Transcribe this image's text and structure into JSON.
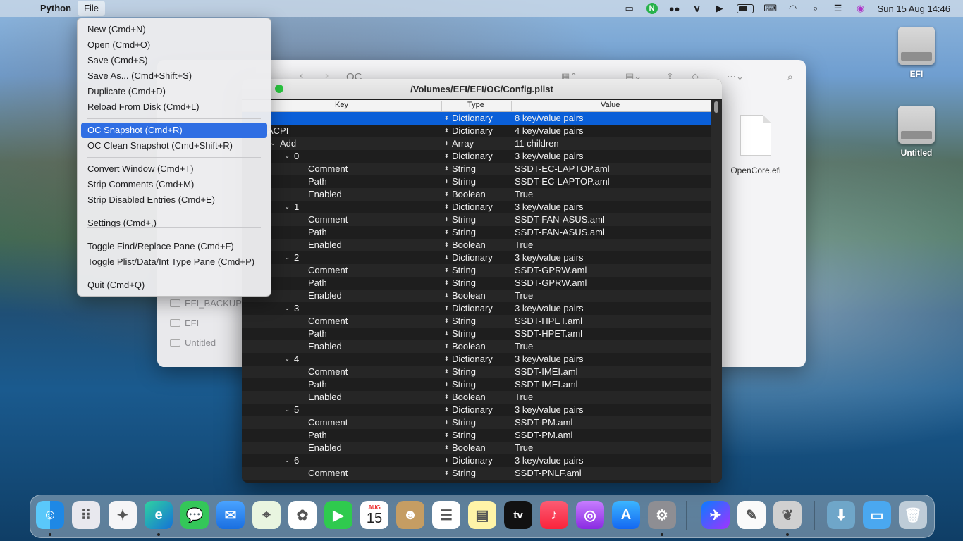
{
  "menubar": {
    "app_name": "Python",
    "menus": [
      "File"
    ],
    "status_icons": [
      "disk-utility-icon",
      "n-app-icon",
      "dots-icon",
      "v-app-icon",
      "play-icon",
      "battery-icon",
      "keyboard-icon",
      "wifi-icon",
      "search-icon",
      "control-center-icon",
      "siri-icon"
    ],
    "clock": "Sun 15 Aug  14:46"
  },
  "file_menu": {
    "items": [
      "New (Cmd+N)",
      "Open (Cmd+O)",
      "Save (Cmd+S)",
      "Save As... (Cmd+Shift+S)",
      "Duplicate (Cmd+D)",
      "Reload From Disk (Cmd+L)",
      "OC Snapshot (Cmd+R)",
      "OC Clean Snapshot (Cmd+Shift+R)",
      "Convert Window (Cmd+T)",
      "Strip Comments (Cmd+M)",
      "Strip Disabled Entries (Cmd+E)",
      "Settings (Cmd+,)",
      "Toggle Find/Replace Pane (Cmd+F)",
      "Toggle Plist/Data/Int Type Pane (Cmd+P)",
      "Quit (Cmd+Q)"
    ],
    "highlighted": "OC Snapshot (Cmd+R)"
  },
  "finder": {
    "title": "OC",
    "sidebar": [
      "EFI_BACKUP",
      "EFI",
      "Untitled"
    ],
    "file_name": "OpenCore.efi"
  },
  "plist": {
    "title": "/Volumes/EFI/EFI/OC/Config.plist",
    "col_key": "Key",
    "col_type": "Type",
    "col_value": "Value",
    "rows": [
      {
        "key": "",
        "type": "Dictionary",
        "value": "8 key/value pairs"
      },
      {
        "key": "ACPI",
        "type": "Dictionary",
        "value": "4 key/value pairs"
      },
      {
        "key": "Add",
        "type": "Array",
        "value": "11 children"
      },
      {
        "key": "0",
        "type": "Dictionary",
        "value": "3 key/value pairs"
      },
      {
        "key": "Comment",
        "type": "String",
        "value": "SSDT-EC-LAPTOP.aml"
      },
      {
        "key": "Path",
        "type": "String",
        "value": "SSDT-EC-LAPTOP.aml"
      },
      {
        "key": "Enabled",
        "type": "Boolean",
        "value": "True"
      },
      {
        "key": "1",
        "type": "Dictionary",
        "value": "3 key/value pairs"
      },
      {
        "key": "Comment",
        "type": "String",
        "value": "SSDT-FAN-ASUS.aml"
      },
      {
        "key": "Path",
        "type": "String",
        "value": "SSDT-FAN-ASUS.aml"
      },
      {
        "key": "Enabled",
        "type": "Boolean",
        "value": "True"
      },
      {
        "key": "2",
        "type": "Dictionary",
        "value": "3 key/value pairs"
      },
      {
        "key": "Comment",
        "type": "String",
        "value": "SSDT-GPRW.aml"
      },
      {
        "key": "Path",
        "type": "String",
        "value": "SSDT-GPRW.aml"
      },
      {
        "key": "Enabled",
        "type": "Boolean",
        "value": "True"
      },
      {
        "key": "3",
        "type": "Dictionary",
        "value": "3 key/value pairs"
      },
      {
        "key": "Comment",
        "type": "String",
        "value": "SSDT-HPET.aml"
      },
      {
        "key": "Path",
        "type": "String",
        "value": "SSDT-HPET.aml"
      },
      {
        "key": "Enabled",
        "type": "Boolean",
        "value": "True"
      },
      {
        "key": "4",
        "type": "Dictionary",
        "value": "3 key/value pairs"
      },
      {
        "key": "Comment",
        "type": "String",
        "value": "SSDT-IMEI.aml"
      },
      {
        "key": "Path",
        "type": "String",
        "value": "SSDT-IMEI.aml"
      },
      {
        "key": "Enabled",
        "type": "Boolean",
        "value": "True"
      },
      {
        "key": "5",
        "type": "Dictionary",
        "value": "3 key/value pairs"
      },
      {
        "key": "Comment",
        "type": "String",
        "value": "SSDT-PM.aml"
      },
      {
        "key": "Path",
        "type": "String",
        "value": "SSDT-PM.aml"
      },
      {
        "key": "Enabled",
        "type": "Boolean",
        "value": "True"
      },
      {
        "key": "6",
        "type": "Dictionary",
        "value": "3 key/value pairs"
      },
      {
        "key": "Comment",
        "type": "String",
        "value": "SSDT-PNLF.aml"
      }
    ]
  },
  "desktop": {
    "icons": [
      "EFI",
      "Untitled"
    ]
  },
  "dock": {
    "apps": [
      "Finder",
      "Launchpad",
      "Safari",
      "Edge",
      "Messages",
      "Mail",
      "Maps",
      "Photos",
      "FaceTime",
      "Calendar",
      "Contacts",
      "Reminders",
      "Notes",
      "TV",
      "Music",
      "Podcasts",
      "App Store",
      "System Preferences",
      "Messenger",
      "TextEdit",
      "ProperTree",
      "Downloads",
      "Folder",
      "Trash"
    ],
    "calendar_month": "AUG",
    "calendar_day": "15",
    "tv_label": "tv"
  }
}
